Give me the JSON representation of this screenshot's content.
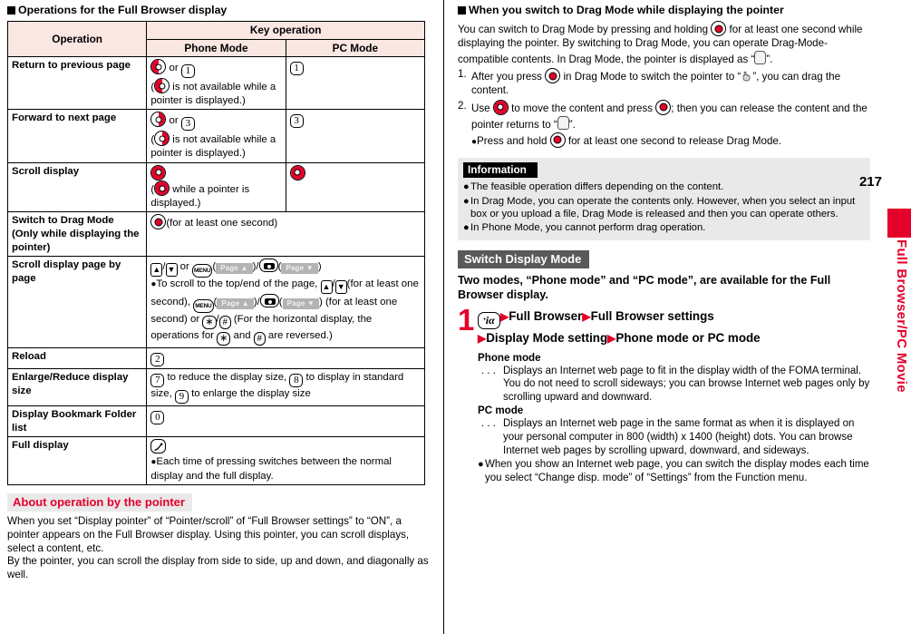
{
  "page_number": "217",
  "side_tab": {
    "label": "Full Browser/PC Movie"
  },
  "left": {
    "heading": "Operations for the Full Browser display",
    "table": {
      "headers": {
        "operation": "Operation",
        "key_operation": "Key operation",
        "phone_mode": "Phone Mode",
        "pc_mode": "PC Mode"
      },
      "rows": [
        {
          "operation": "Return to previous page",
          "phone_parts": {
            "or": "or",
            "note_open": "(",
            "note": "is not available while a pointer is displayed.)"
          },
          "phone_key_digit": "1",
          "pc_key_digit": "1"
        },
        {
          "operation": "Forward to next page",
          "phone_parts": {
            "or": "or",
            "note_open": "(",
            "note": "is not available while a pointer is displayed.)"
          },
          "phone_key_digit": "3",
          "pc_key_digit": "3"
        },
        {
          "operation": "Scroll display",
          "note_open": "(",
          "note": "while a pointer is displayed.)"
        },
        {
          "operation": "Switch to Drag Mode",
          "operation_sub": "(Only while displaying the pointer)",
          "note": "(for at least one second)"
        },
        {
          "operation": "Scroll display page by page",
          "line1_or": "or",
          "softkey_up": "Page",
          "softkey_down": "Page",
          "bullet": "To scroll to the top/end of the page,",
          "bullet_part2": "(for at least one second),",
          "bullet_part3": "(for at least one second) or",
          "bullet_part4": "(For the horizontal display, the operations for",
          "bullet_part5": "and",
          "bullet_part6": "are reversed.)",
          "star": "∗",
          "hash": "#"
        },
        {
          "operation": "Reload",
          "key_digit": "2"
        },
        {
          "operation": "Enlarge/Reduce display size",
          "seg1": "to reduce the display size,",
          "seg2": "to display in standard size,",
          "seg3": "to enlarge the display size",
          "key1": "7",
          "key2": "8",
          "key3": "9"
        },
        {
          "operation": "Display Bookmark Folder list",
          "key_digit": "0"
        },
        {
          "operation": "Full display",
          "bullet": "Each time of pressing switches between the normal display and the full display."
        }
      ]
    },
    "pointer_section": {
      "heading": "About operation by the pointer",
      "paragraph1": "When you set “Display pointer” of “Pointer/scroll” of “Full Browser settings” to “ON”, a pointer appears on the Full Browser display. Using this pointer, you can scroll displays, select a content, etc.",
      "paragraph2": "By the pointer, you can scroll the display from side to side, up and down, and diagonally as well."
    }
  },
  "right": {
    "drag_section": {
      "heading": "When you switch to Drag Mode while displaying the pointer",
      "intro_part1": "You can switch to Drag Mode by pressing and holding",
      "intro_part2": "for at least one second while displaying the pointer. By switching to Drag Mode, you can operate Drag-Mode-compatible contents. In Drag Mode, the pointer is displayed as “",
      "intro_part3": "”.",
      "steps": [
        {
          "num": "1.",
          "part1": "After you press",
          "part2": "in Drag Mode to switch the pointer to “",
          "part3": "”, you can drag the content."
        },
        {
          "num": "2.",
          "part1": "Use",
          "part2": "to move the content and press",
          "part3": "; then you can release the content and the pointer returns to “",
          "part4": "”.",
          "bullet_part1": "Press and hold",
          "bullet_part2": "for at least one second to release Drag Mode."
        }
      ]
    },
    "information": {
      "title": "Information",
      "items": [
        "The feasible operation differs depending on the content.",
        "In Drag Mode, you can operate the contents only. However, when you select an input box or you upload a file, Drag Mode is released and then you can operate others.",
        "In Phone Mode, you cannot perform drag operation."
      ]
    },
    "switch_display_mode": {
      "heading": "Switch Display Mode",
      "intro": "Two modes, “Phone mode” and “PC mode”, are available for the Full Browser display.",
      "step": {
        "number": "1",
        "ikey": "iα",
        "seg1": "Full Browser",
        "seg2": "Full Browser settings",
        "seg3": "Display Mode setting",
        "seg4": "Phone mode or PC mode"
      },
      "definitions": [
        {
          "term": "Phone mode",
          "lead": ". . .",
          "desc": "Displays an Internet web page to fit in the display width of the FOMA terminal. You do not need to scroll sideways; you can browse Internet web pages only by scrolling upward and downward."
        },
        {
          "term": "PC mode",
          "lead": ". . .",
          "desc": "Displays an Internet web page in the same format as when it is displayed on your personal computer in 800 (width) x 1400 (height) dots. You can browse Internet web pages by scrolling upward, downward, and sideways."
        }
      ],
      "note": "When you show an Internet web page, you can switch the display modes each time you select “Change disp. mode” of “Settings” from the Function menu."
    }
  }
}
